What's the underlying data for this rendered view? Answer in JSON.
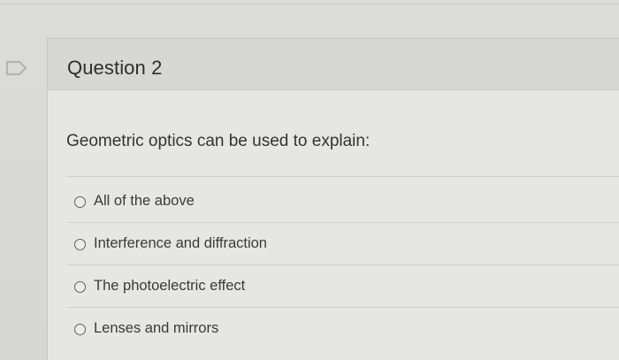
{
  "icons": {
    "flag": "flag-icon"
  },
  "question": {
    "title": "Question 2",
    "text": "Geometric optics can be used to explain:",
    "options": [
      {
        "label": "All of the above"
      },
      {
        "label": "Interference and diffraction"
      },
      {
        "label": "The photoelectric effect"
      },
      {
        "label": "Lenses and mirrors"
      }
    ]
  }
}
